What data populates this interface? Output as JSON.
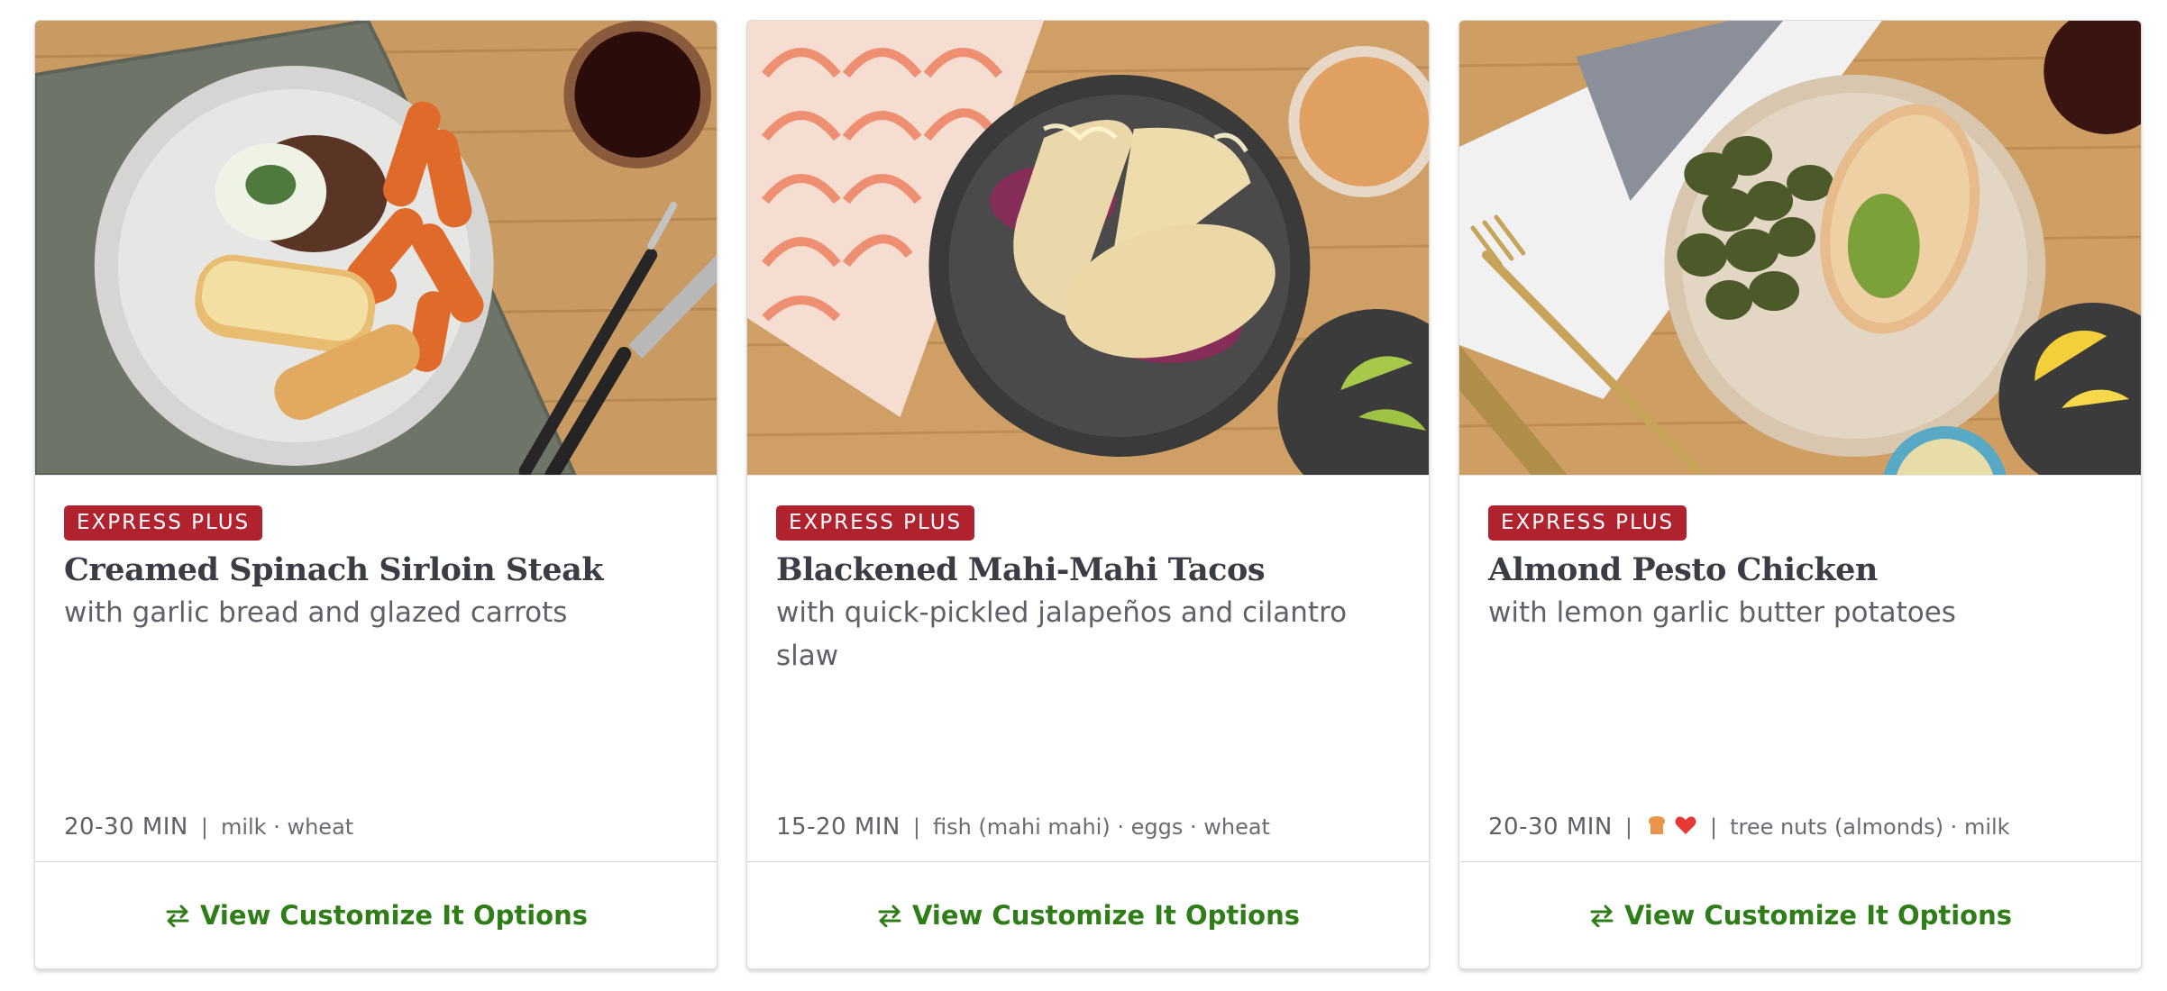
{
  "cards": [
    {
      "image_alt": "Creamed Spinach Sirloin Steak plated with garlic bread and glazed carrots",
      "badge": "EXPRESS PLUS",
      "title": "Creamed Spinach Sirloin Steak",
      "subtitle": "with garlic bread and glazed carrots",
      "time": "20-30 MIN",
      "allergens": "milk · wheat",
      "icons": [],
      "action_label": "View Customize It Options"
    },
    {
      "image_alt": "Blackened Mahi-Mahi Tacos on a dark plate",
      "badge": "EXPRESS PLUS",
      "title": "Blackened Mahi-Mahi Tacos",
      "subtitle": "with quick-pickled jalapeños and cilantro slaw",
      "time": "15-20 MIN",
      "allergens": "fish (mahi mahi) · eggs · wheat",
      "icons": [],
      "action_label": "View Customize It Options"
    },
    {
      "image_alt": "Almond Pesto Chicken with lemon garlic butter potatoes",
      "badge": "EXPRESS PLUS",
      "title": "Almond Pesto Chicken",
      "subtitle": "with lemon garlic butter potatoes",
      "time": "20-30 MIN",
      "allergens": "tree nuts (almonds) · milk",
      "icons": [
        "carb-conscious-icon",
        "heart-healthy-icon"
      ],
      "action_label": "View Customize It Options"
    }
  ],
  "separator": "|",
  "colors": {
    "badge": "#b0232e",
    "action": "#2e7d18",
    "title": "#3b3d45",
    "heart": "#e53935",
    "carb": "#e8954a"
  }
}
